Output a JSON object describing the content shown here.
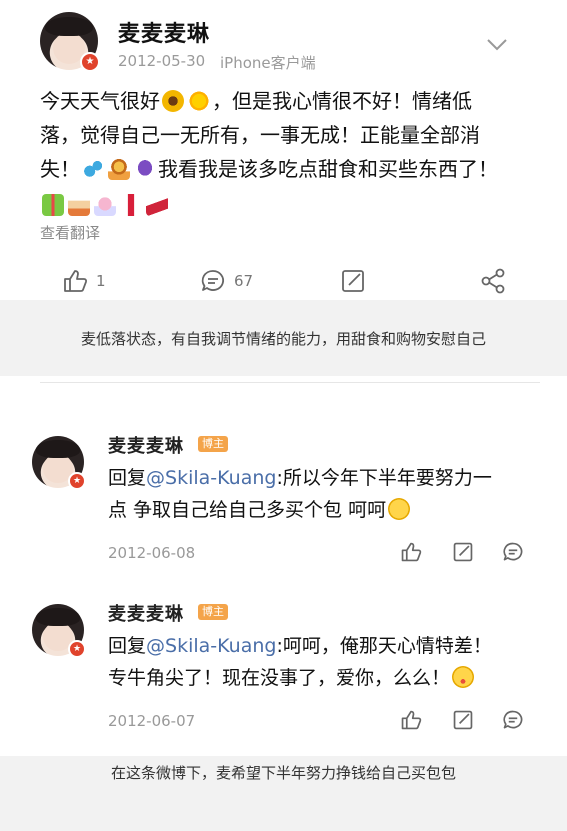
{
  "post": {
    "author": "麦麦麦琳",
    "date": "2012-05-30",
    "source": "iPhone客户端",
    "content_line1": "今天天气很好",
    "content_line1b": "，但是我心情很不好！情绪低",
    "content_line2": "落，觉得自己一无所有，一事无成！正能量全部消",
    "content_line3a": "失！",
    "content_line3b": "我看我是该多吃点甜食和买些东西了！",
    "translate": "查看翻译",
    "likes": "1",
    "comments": "67"
  },
  "caption1": "麦低落状态，有自我调节情绪的能力，用甜食和购物安慰自己",
  "replies": [
    {
      "author": "麦麦麦琳",
      "tag": "博主",
      "prefix": "回复",
      "mention": "@Skila-Kuang",
      "text1": ":所以今年下半年要努力一",
      "text2": "点 争取自己给自己多买个包 呵呵",
      "date": "2012-06-08"
    },
    {
      "author": "麦麦麦琳",
      "tag": "博主",
      "prefix": "回复",
      "mention": "@Skila-Kuang",
      "text1": ":呵呵，俺那天心情特差！",
      "text2": "专牛角尖了！现在没事了，爱你，么么！",
      "date": "2012-06-07"
    }
  ],
  "caption2": "在这条微博下，麦希望下半年努力挣钱给自己买包包"
}
